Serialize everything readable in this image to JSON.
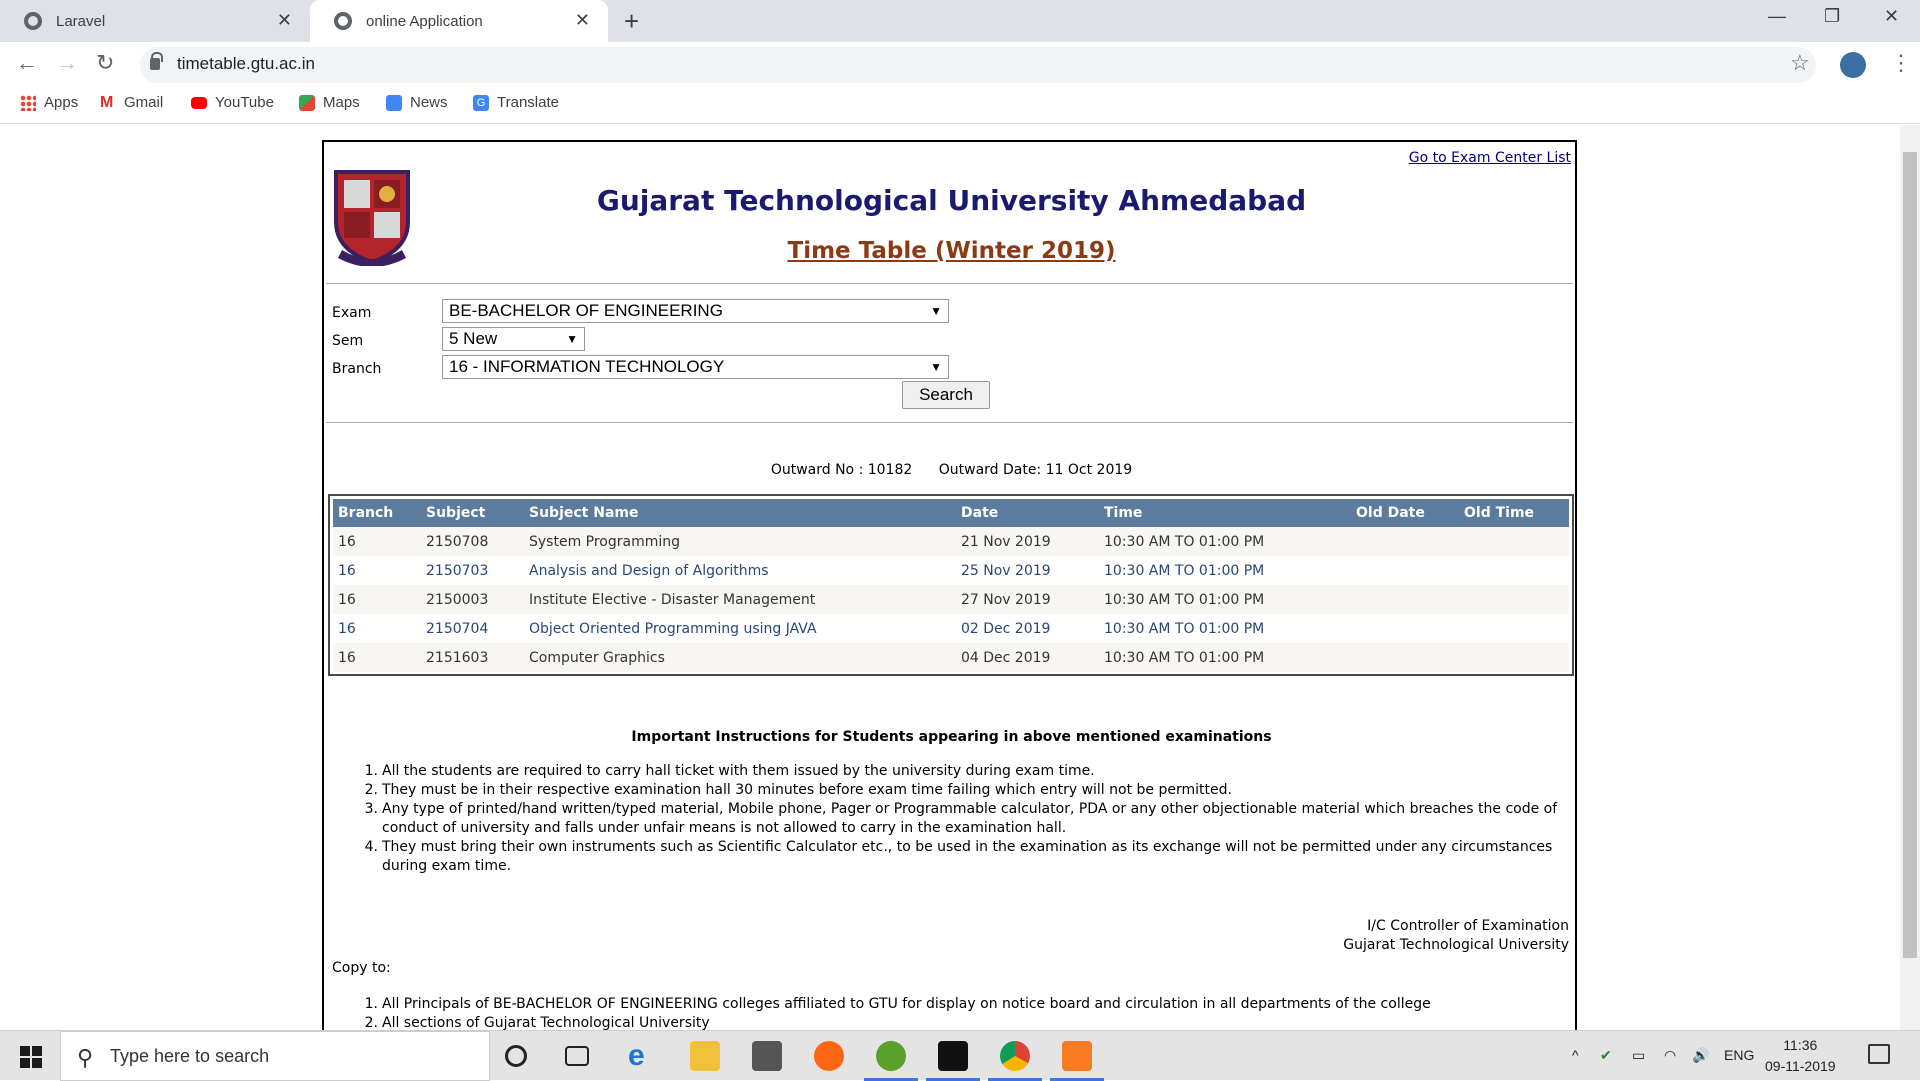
{
  "browser": {
    "tabs": [
      {
        "label": "Laravel",
        "active": false
      },
      {
        "label": "online Application",
        "active": true
      }
    ],
    "url": "timetable.gtu.ac.in",
    "bookmarks": [
      "Apps",
      "Gmail",
      "YouTube",
      "Maps",
      "News",
      "Translate"
    ]
  },
  "page": {
    "exam_center_link": "Go to Exam Center List",
    "title": "Gujarat Technological University Ahmedabad",
    "subtitle": "Time Table (Winter 2019)",
    "form": {
      "exam_label": "Exam",
      "exam_value": "BE-BACHELOR OF ENGINEERING",
      "sem_label": "Sem",
      "sem_value": "5 New",
      "branch_label": "Branch",
      "branch_value": "16 - INFORMATION TECHNOLOGY",
      "search_label": "Search"
    },
    "outward_no": "Outward No : 10182",
    "outward_date": "Outward Date: 11 Oct 2019",
    "table": {
      "headers": [
        "Branch",
        "Subject",
        "Subject Name",
        "Date",
        "Time",
        "Old Date",
        "Old Time"
      ],
      "rows": [
        [
          "16",
          "2150708",
          "System Programming",
          "21 Nov 2019",
          "10:30 AM TO 01:00 PM",
          "",
          ""
        ],
        [
          "16",
          "2150703",
          "Analysis and Design of Algorithms",
          "25 Nov 2019",
          "10:30 AM TO 01:00 PM",
          "",
          ""
        ],
        [
          "16",
          "2150003",
          "Institute Elective - Disaster Management",
          "27 Nov 2019",
          "10:30 AM TO 01:00 PM",
          "",
          ""
        ],
        [
          "16",
          "2150704",
          "Object Oriented Programming using JAVA",
          "02 Dec 2019",
          "10:30 AM TO 01:00 PM",
          "",
          ""
        ],
        [
          "16",
          "2151603",
          "Computer Graphics",
          "04 Dec 2019",
          "10:30 AM TO 01:00 PM",
          "",
          ""
        ]
      ]
    },
    "instructions_title": "Important Instructions for Students appearing in above mentioned examinations",
    "instructions": [
      "All the students are required to carry hall ticket with them issued by the university during exam time.",
      "They must be in their respective examination hall 30 minutes before exam time failing which entry will not be permitted.",
      "Any type of printed/hand written/typed material, Mobile phone, Pager or Programmable calculator, PDA or any other objectionable material which breaches the code of conduct of university and falls under unfair means is not allowed to carry in the examination hall.",
      "They must bring their own instruments such as Scientific Calculator etc., to be used in the examination as its exchange will not be permitted under any circumstances during exam time."
    ],
    "signature": [
      "I/C Controller of Examination",
      "Gujarat Technological University"
    ],
    "copy_to_label": "Copy to:",
    "copy_to": [
      "All Principals of BE-BACHELOR OF ENGINEERING colleges affiliated to GTU for display on notice board and circulation in all departments of the college",
      "All sections of Gujarat Technological University"
    ]
  },
  "taskbar": {
    "search_placeholder": "Type here to search",
    "language": "ENG",
    "time": "11:36",
    "date": "09-11-2019"
  }
}
